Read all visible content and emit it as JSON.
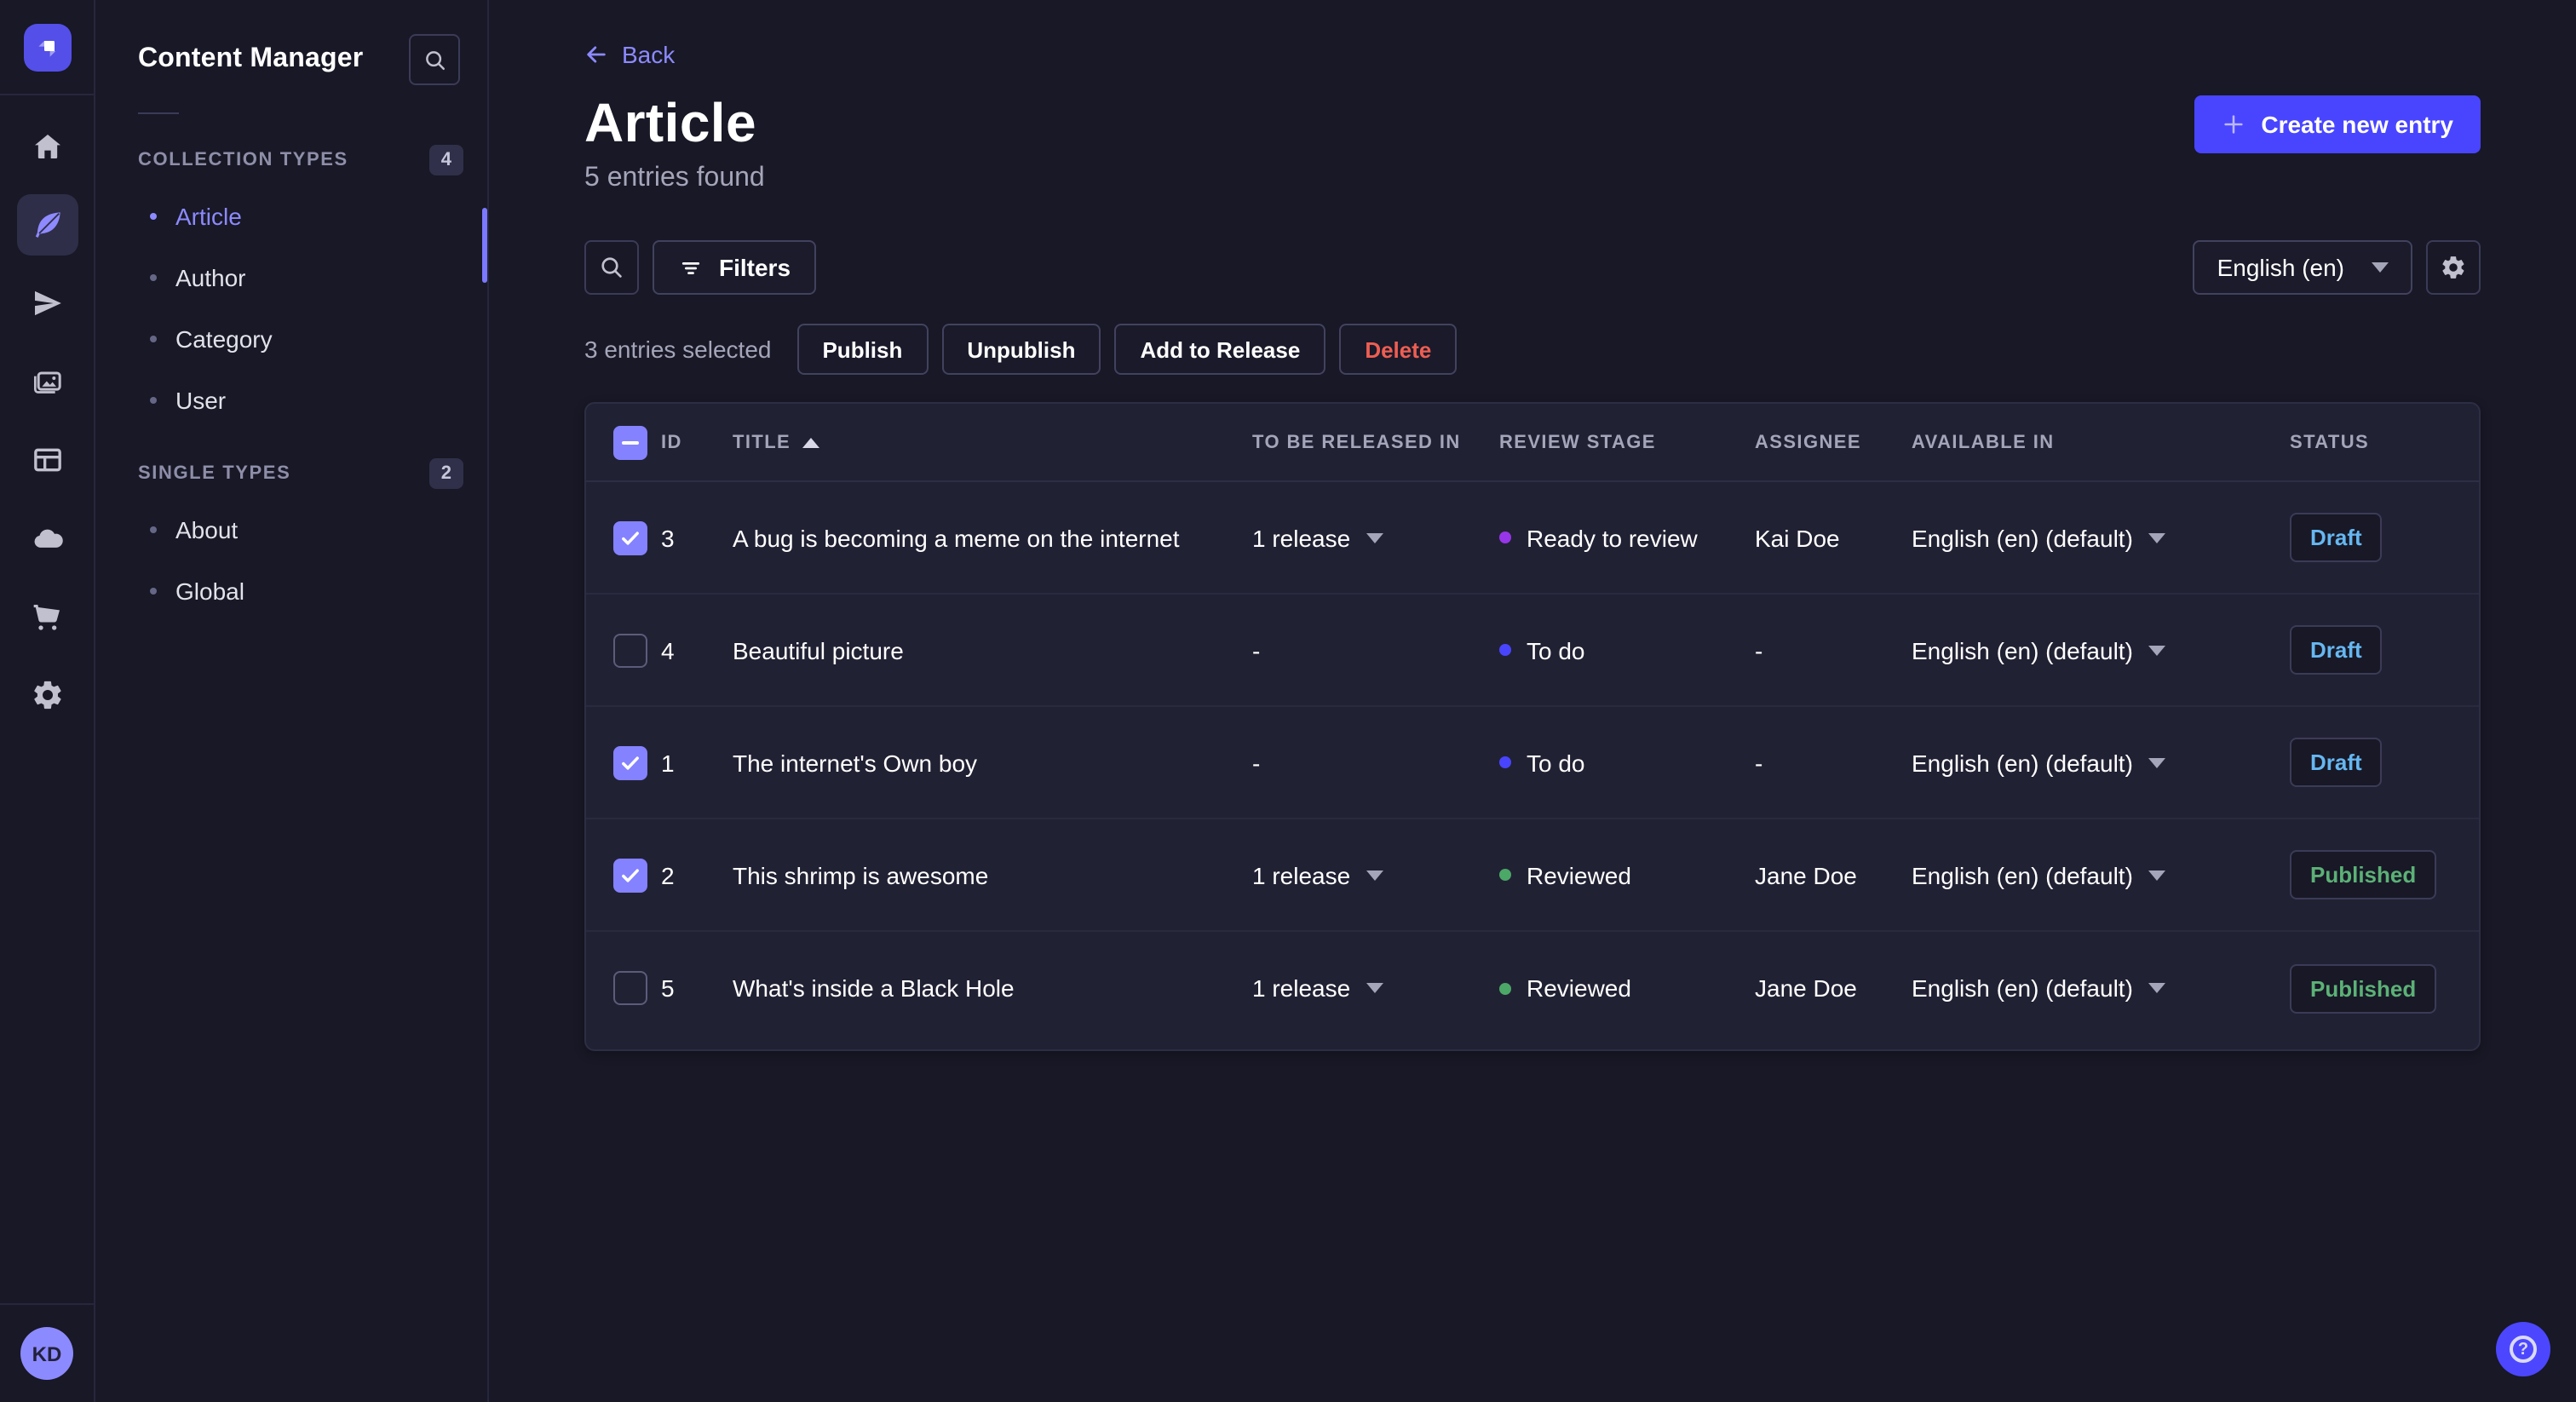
{
  "rail": {
    "logo_icon": "strapi-logo",
    "icons": [
      "home",
      "content-manager-feather",
      "releases-paper-plane",
      "media-library",
      "content-type-builder",
      "deploy-cloud",
      "marketplace-cart",
      "settings-gear"
    ],
    "active_icon": "content-manager-feather",
    "avatar_initials": "KD"
  },
  "sidebar": {
    "title": "Content Manager",
    "search_icon": "search",
    "sections": [
      {
        "label": "COLLECTION TYPES",
        "count": "4",
        "items": [
          {
            "label": "Article",
            "active": true
          },
          {
            "label": "Author"
          },
          {
            "label": "Category"
          },
          {
            "label": "User"
          }
        ]
      },
      {
        "label": "SINGLE TYPES",
        "count": "2",
        "items": [
          {
            "label": "About"
          },
          {
            "label": "Global"
          }
        ]
      }
    ]
  },
  "header": {
    "back_label": "Back",
    "title": "Article",
    "subtitle": "5 entries found",
    "create_label": "Create new entry"
  },
  "toolbar": {
    "search_icon": "search",
    "filters_label": "Filters",
    "locale_value": "English (en)",
    "settings_icon": "gear"
  },
  "selection": {
    "summary": "3 entries selected",
    "publish": "Publish",
    "unpublish": "Unpublish",
    "add_to_release": "Add to Release",
    "delete": "Delete"
  },
  "table": {
    "columns": {
      "id": "ID",
      "title": "TITLE",
      "release": "TO BE RELEASED IN",
      "stage": "REVIEW STAGE",
      "assignee": "ASSIGNEE",
      "available": "AVAILABLE IN",
      "status": "STATUS"
    },
    "sort": {
      "column": "TITLE",
      "direction": "asc"
    },
    "rows": [
      {
        "checked": true,
        "id": "3",
        "title": "A bug is becoming a meme on the internet",
        "release": "1 release",
        "stage": "Ready to review",
        "stage_color": "#9736e8",
        "assignee": "Kai Doe",
        "available": "English (en) (default)",
        "status": "Draft"
      },
      {
        "checked": false,
        "id": "4",
        "title": "Beautiful picture",
        "release": "-",
        "stage": "To do",
        "stage_color": "#4945ff",
        "assignee": "-",
        "available": "English (en) (default)",
        "status": "Draft"
      },
      {
        "checked": true,
        "id": "1",
        "title": "The internet's Own boy",
        "release": "-",
        "stage": "To do",
        "stage_color": "#4945ff",
        "assignee": "-",
        "available": "English (en) (default)",
        "status": "Draft"
      },
      {
        "checked": true,
        "id": "2",
        "title": "This shrimp is awesome",
        "release": "1 release",
        "stage": "Reviewed",
        "stage_color": "#4ca867",
        "assignee": "Jane Doe",
        "available": "English (en) (default)",
        "status": "Published"
      },
      {
        "checked": false,
        "id": "5",
        "title": "What's inside a Black Hole",
        "release": "1 release",
        "stage": "Reviewed",
        "stage_color": "#4ca867",
        "assignee": "Jane Doe",
        "available": "English (en) (default)",
        "status": "Published"
      }
    ]
  },
  "colors": {
    "accent": "#4945ff",
    "link": "#8c8aff",
    "draft_text": "#66b7f1",
    "published_text": "#5cb176",
    "danger_text": "#ee5e52",
    "panel_bg": "#212134",
    "page_bg": "#181826"
  },
  "help": {
    "icon": "question-mark"
  }
}
